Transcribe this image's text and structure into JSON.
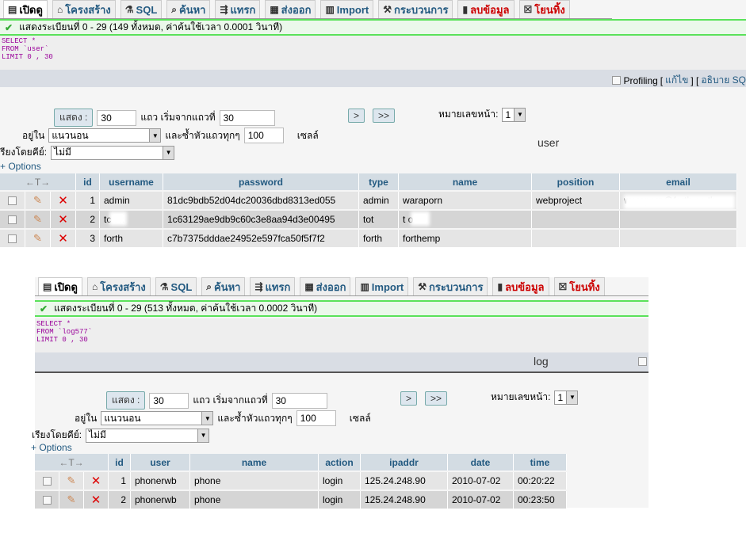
{
  "panels": [
    {
      "tabs": [
        {
          "label": "เปิดดู",
          "icon": "browse-icon",
          "active": true
        },
        {
          "label": "โครงสร้าง",
          "icon": "structure-icon"
        },
        {
          "label": "SQL",
          "icon": "sql-icon"
        },
        {
          "label": "ค้นหา",
          "icon": "search-icon"
        },
        {
          "label": "แทรก",
          "icon": "insert-icon"
        },
        {
          "label": "ส่งออก",
          "icon": "export-icon"
        },
        {
          "label": "Import",
          "icon": "import-icon"
        },
        {
          "label": "กระบวนการ",
          "icon": "operations-icon"
        },
        {
          "label": "ลบข้อมูล",
          "icon": "empty-icon",
          "red": true
        },
        {
          "label": "โยนทิ้ง",
          "icon": "drop-icon",
          "red": true
        }
      ],
      "status": "แสดงระเบียนที่ 0 - 29 (149 ทั้งหมด, ค่าค้นใช้เวลา 0.0001 วินาที)",
      "sql": [
        "SELECT *",
        "FROM `user`",
        "LIMIT 0 , 30"
      ],
      "profiling": "Profiling",
      "edit_link": "แก้ไข",
      "explain_link": "อธิบาย SQ",
      "table_caption": "user",
      "controls": {
        "show": "แสดง :",
        "rows": "30",
        "rows_label": "แถว เริ่มจากแถวที่",
        "start": "30",
        "in_label": "อยู่ใน",
        "mode": "แนวนอน",
        "repeat_label": "และซ้ำหัวแถวทุกๆ",
        "repeat": "100",
        "cells_label": "เซลล์",
        "sort_label": "เรียงโดยคีย์:",
        "sort": "ไม่มี",
        "next": ">",
        "last": ">>",
        "page_label": "หมายเลขหน้า:",
        "page": "1",
        "options": "+ Options"
      },
      "columns": [
        "id",
        "username",
        "password",
        "type",
        "name",
        "position",
        "email"
      ],
      "rows": [
        [
          "1",
          "admin",
          "81dc9bdb52d04dc20036dbd8313ed055",
          "admin",
          "waraporn",
          "webproject",
          "waraporn@forth.co.th"
        ],
        [
          "2",
          "tc    7k",
          "1c63129ae9db9c60c3e8aa94d3e00495",
          "tot",
          "t       o",
          "",
          ""
        ],
        [
          "3",
          "forth",
          "c7b7375dddae24952e597fca50f5f7f2",
          "forth",
          "forthemp",
          "",
          ""
        ]
      ]
    },
    {
      "tabs": [
        {
          "label": "เปิดดู",
          "icon": "browse-icon",
          "active": true
        },
        {
          "label": "โครงสร้าง",
          "icon": "structure-icon"
        },
        {
          "label": "SQL",
          "icon": "sql-icon"
        },
        {
          "label": "ค้นหา",
          "icon": "search-icon"
        },
        {
          "label": "แทรก",
          "icon": "insert-icon"
        },
        {
          "label": "ส่งออก",
          "icon": "export-icon"
        },
        {
          "label": "Import",
          "icon": "import-icon"
        },
        {
          "label": "กระบวนการ",
          "icon": "operations-icon"
        },
        {
          "label": "ลบข้อมูล",
          "icon": "empty-icon",
          "red": true
        },
        {
          "label": "โยนทิ้ง",
          "icon": "drop-icon",
          "red": true
        }
      ],
      "status": "แสดงระเบียนที่ 0 - 29 (513 ทั้งหมด, ค่าค้นใช้เวลา 0.0002 วินาที)",
      "sql": [
        "SELECT *",
        "FROM `log577`",
        "LIMIT 0 , 30"
      ],
      "table_caption": "log",
      "controls": {
        "show": "แสดง :",
        "rows": "30",
        "rows_label": "แถว เริ่มจากแถวที่",
        "start": "30",
        "in_label": "อยู่ใน",
        "mode": "แนวนอน",
        "repeat_label": "และซ้ำหัวแถวทุกๆ",
        "repeat": "100",
        "cells_label": "เซลล์",
        "sort_label": "เรียงโดยคีย์:",
        "sort": "ไม่มี",
        "next": ">",
        "last": ">>",
        "page_label": "หมายเลขหน้า:",
        "page": "1",
        "options": "+ Options"
      },
      "columns": [
        "id",
        "user",
        "name",
        "action",
        "ipaddr",
        "date",
        "time"
      ],
      "rows": [
        [
          "1",
          "phonerwb",
          "phone",
          "login",
          "125.24.248.90",
          "2010-07-02",
          "00:20:22"
        ],
        [
          "2",
          "phonerwb",
          "phone",
          "login",
          "125.24.248.90",
          "2010-07-02",
          "00:23:50"
        ]
      ]
    }
  ]
}
